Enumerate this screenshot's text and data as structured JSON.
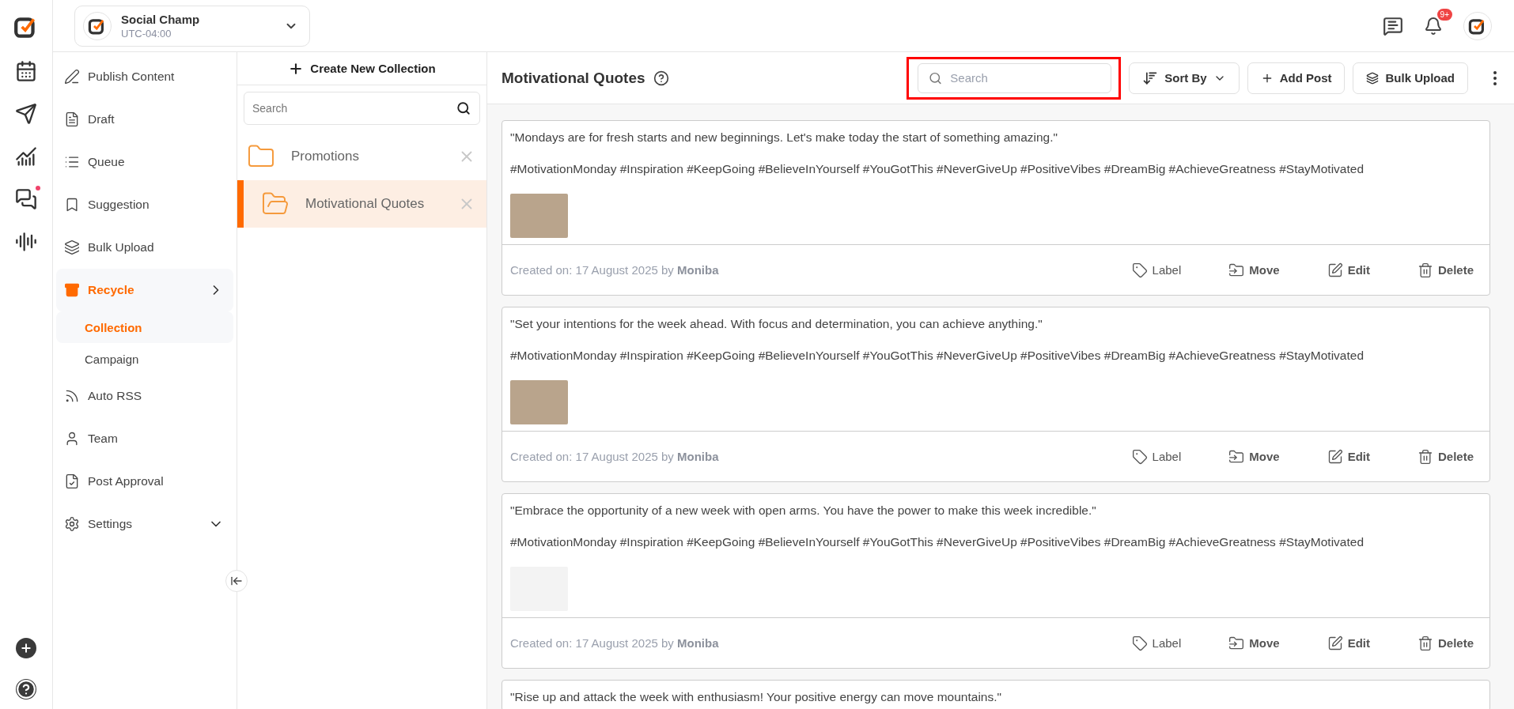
{
  "workspace": {
    "name": "Social Champ",
    "timezone": "UTC-04:00"
  },
  "rail": {
    "chat_unread": true
  },
  "notifications": {
    "badge": "9+"
  },
  "nav": [
    {
      "label": "Publish Content",
      "selected": false
    },
    {
      "label": "Draft",
      "selected": false
    },
    {
      "label": "Queue",
      "selected": false
    },
    {
      "label": "Suggestion",
      "selected": false
    },
    {
      "label": "Bulk Upload",
      "selected": false
    },
    {
      "label": "Recycle",
      "selected": true,
      "expanded": true,
      "children": [
        {
          "label": "Collection",
          "selected": true
        },
        {
          "label": "Campaign",
          "selected": false
        }
      ]
    },
    {
      "label": "Auto RSS",
      "selected": false
    },
    {
      "label": "Team",
      "selected": false
    },
    {
      "label": "Post Approval",
      "selected": false
    },
    {
      "label": "Settings",
      "selected": false,
      "expanded": false
    }
  ],
  "collections_panel": {
    "create_label": "Create New Collection",
    "search_placeholder": "Search",
    "items": [
      {
        "name": "Promotions",
        "selected": false
      },
      {
        "name": "Motivational Quotes",
        "selected": true
      }
    ]
  },
  "header": {
    "title": "Motivational Quotes",
    "search": {
      "placeholder": "Search",
      "highlighted": true
    },
    "sort_label": "Sort By",
    "buttons": [
      "Add Post",
      "Bulk Upload"
    ]
  },
  "posts": [
    {
      "text": "\"Mondays are for fresh starts and new beginnings. Let's make today the start of something amazing.\"",
      "hashtags": "#MotivationMonday #Inspiration #KeepGoing #BelieveInYourself #YouGotThis #NeverGiveUp #PositiveVibes #DreamBig #AchieveGreatness #StayMotivated",
      "image": true,
      "created": "Created on: 17 August 2025 by **Moniba**",
      "actions": [
        "Label",
        "Move",
        "Edit",
        "Delete"
      ]
    },
    {
      "text": "\"Set your intentions for the week ahead. With focus and determination, you can achieve anything.\"",
      "hashtags": "#MotivationMonday #Inspiration #KeepGoing #BelieveInYourself #YouGotThis #NeverGiveUp #PositiveVibes #DreamBig #AchieveGreatness #StayMotivated",
      "image": true,
      "created": "Created on: 17 August 2025 by **Moniba**",
      "actions": [
        "Label",
        "Move",
        "Edit",
        "Delete"
      ]
    },
    {
      "text": "\"Embrace the opportunity of a new week with open arms. You have the power to make this week incredible.\"",
      "hashtags": "#MotivationMonday #Inspiration #KeepGoing #BelieveInYourself #YouGotThis #NeverGiveUp #PositiveVibes #DreamBig #AchieveGreatness #StayMotivated",
      "image": true,
      "created": "Created on: 17 August 2025 by **Moniba**",
      "actions": [
        "Label",
        "Move",
        "Edit",
        "Delete"
      ]
    },
    {
      "text": "\"Rise up and attack the week with enthusiasm! Your positive energy can move mountains.\""
    }
  ]
}
